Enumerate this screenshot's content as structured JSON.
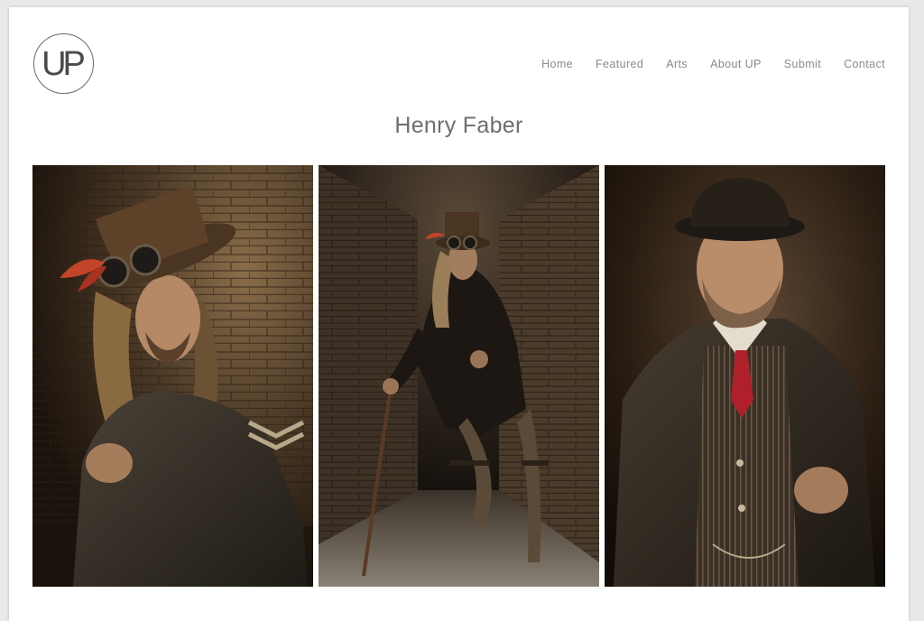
{
  "logo": {
    "text": "UP"
  },
  "nav": {
    "items": [
      {
        "label": "Home"
      },
      {
        "label": "Featured"
      },
      {
        "label": "Arts"
      },
      {
        "label": "About UP"
      },
      {
        "label": "Submit"
      },
      {
        "label": "Contact"
      }
    ],
    "text_color": "#8a8a8a"
  },
  "page_title": "Henry Faber",
  "gallery": {
    "photos": [
      {
        "subject": "steampunk man in top hat with goggles and military coat against brick wall"
      },
      {
        "subject": "steampunk figure on spring stilts with cane in dark brick corridor"
      },
      {
        "subject": "bearded man in bowler hat with red tie and tweed coat"
      }
    ]
  },
  "colors": {
    "background": "#e9e9e9",
    "page": "#ffffff",
    "title": "#6e6e6e"
  }
}
